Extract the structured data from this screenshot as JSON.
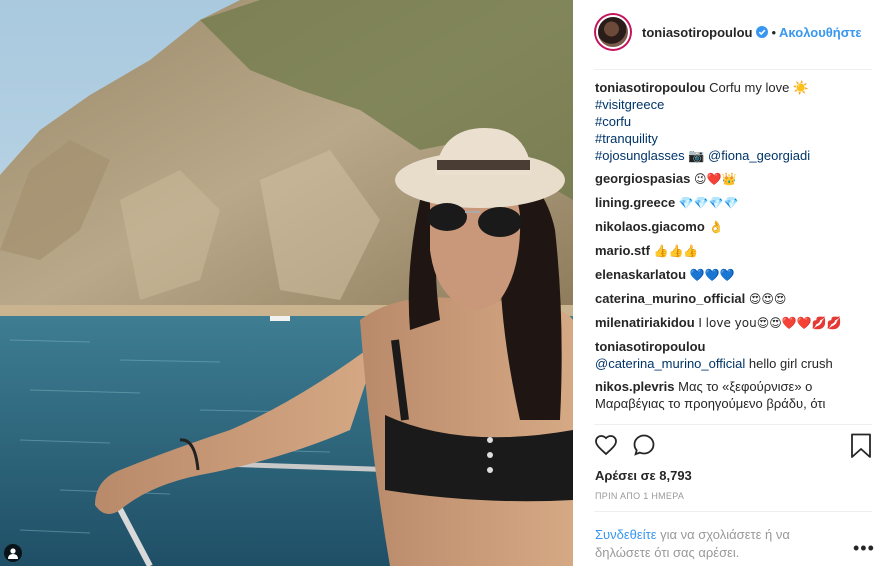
{
  "post": {
    "photo_icon": "user-silhouette-icon"
  },
  "header": {
    "username": "toniasotiropoulou",
    "separator": "•",
    "follow_label": "Ακολουθήστε"
  },
  "comments": [
    {
      "user": "toniasotiropoulou",
      "text": "Corfu my love ☀️",
      "lines": [
        "#visitgreece",
        "#corfu",
        "#tranquility"
      ],
      "last": "#ojosunglasses 📷 @fiona_georgiadi"
    },
    {
      "user": "georgiospasias",
      "text": "😉❤️👑"
    },
    {
      "user": "lining.greece",
      "text": "💎💎💎💎"
    },
    {
      "user": "nikolaos.giacomo",
      "text": "👌"
    },
    {
      "user": "mario.stf",
      "text": "👍👍👍"
    },
    {
      "user": "elenaskarlatou",
      "text": "💙💙💙"
    },
    {
      "user": "caterina_murino_official",
      "text": "😍😍😍"
    },
    {
      "user": "milenatiriakidou",
      "text": "I love you😍😍❤️❤️💋💋"
    },
    {
      "user": "toniasotiropoulou",
      "mention": "@caterina_murino_official",
      "text": "hello girl crush"
    },
    {
      "user": "nikos.plevris",
      "text": "Μας το «ξεφούρνισε» ο Μαραβέγιας το προηγούμενο βράδυ, ότι"
    }
  ],
  "actions": {
    "like_icon": "heart-icon",
    "comment_icon": "comment-icon",
    "save_icon": "bookmark-icon"
  },
  "likes": "Αρέσει σε 8,793",
  "time": "ΠΡΙΝ ΑΠΟ 1 ΗΜΕΡΑ",
  "login": {
    "link": "Συνδεθείτε",
    "rest": " για να σχολιάσετε ή να δηλώσετε ότι σας αρέσει."
  },
  "more_label": "•••"
}
